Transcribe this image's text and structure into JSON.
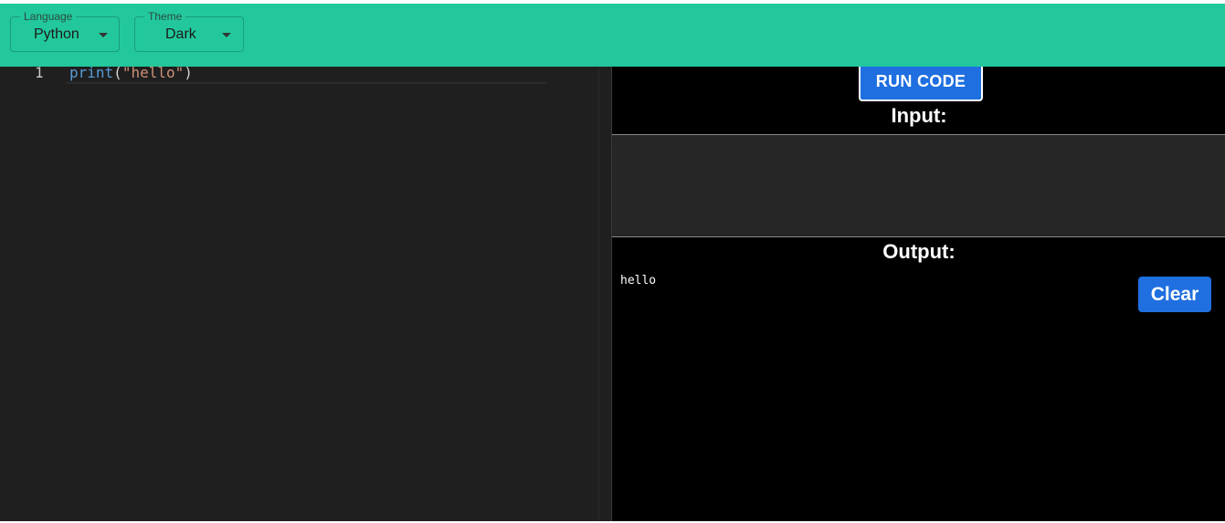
{
  "toolbar": {
    "language_label": "Language",
    "language_value": "Python",
    "theme_label": "Theme",
    "theme_value": "Dark",
    "background_color": "#22c89c"
  },
  "editor": {
    "line_numbers": [
      "1"
    ],
    "lines": [
      {
        "tokens": [
          {
            "text": "print",
            "kind": "function"
          },
          {
            "text": "(",
            "kind": "punctuation"
          },
          {
            "text": "\"hello\"",
            "kind": "string"
          },
          {
            "text": ")",
            "kind": "punctuation"
          }
        ]
      }
    ],
    "background_color": "#1f1f1f"
  },
  "panel": {
    "run_label": "RUN CODE",
    "input_title": "Input:",
    "input_value": "",
    "output_title": "Output:",
    "output_text": "hello",
    "clear_label": "Clear",
    "accent_color": "#1f6fe0"
  },
  "icons": {
    "dropdown": "chevron-down-icon"
  }
}
